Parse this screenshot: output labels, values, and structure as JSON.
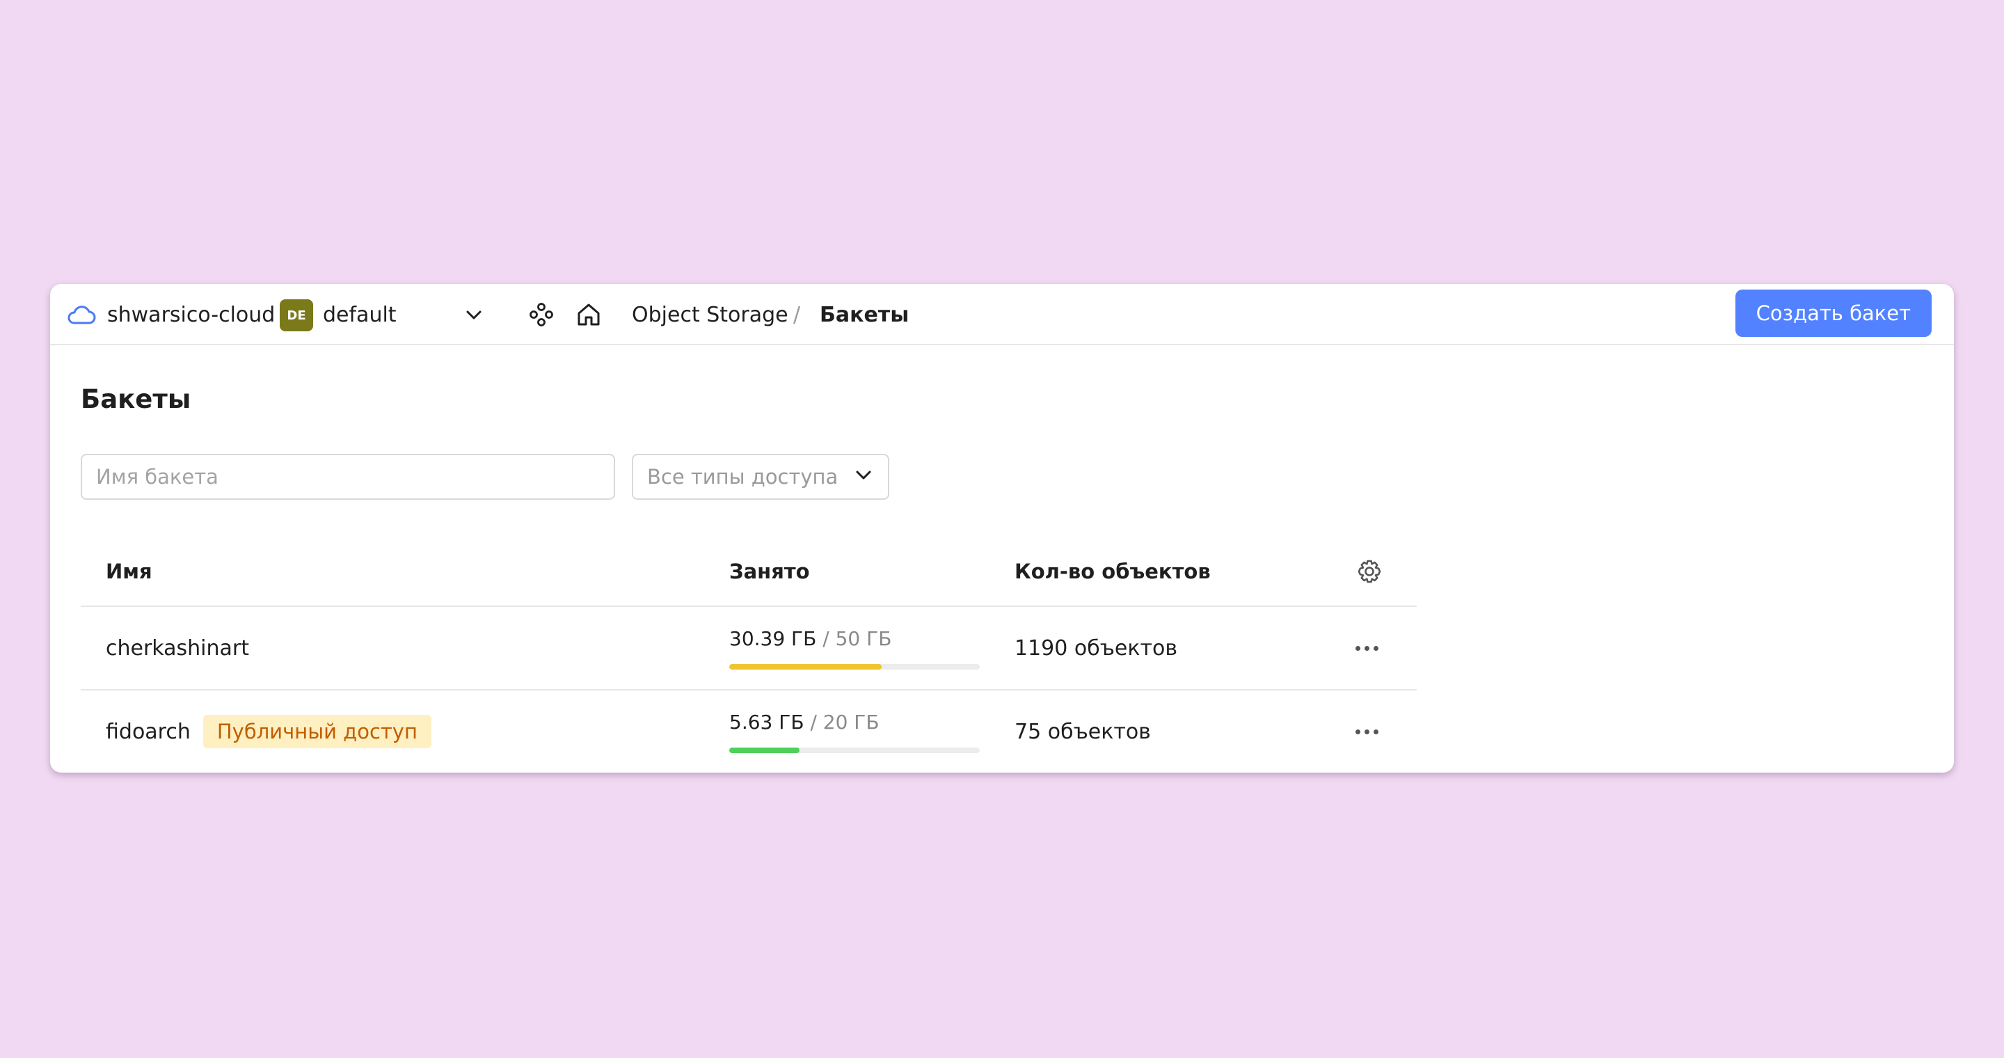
{
  "header": {
    "cloud_name": "shwarsico-cloud",
    "folder_badge": "DE",
    "folder_name": "default",
    "breadcrumb_service": "Object Storage",
    "breadcrumb_separator": "/",
    "breadcrumb_current": "Бакеты",
    "create_button": "Создать бакет"
  },
  "page": {
    "title": "Бакеты",
    "search_placeholder": "Имя бакета",
    "access_filter": "Все типы доступа"
  },
  "table": {
    "columns": {
      "name": "Имя",
      "used": "Занято",
      "count": "Кол-во объектов"
    },
    "rows": [
      {
        "name": "cherkashinart",
        "badge": "",
        "used": "30.39 ГБ",
        "total": "/ 50 ГБ",
        "usage_fraction": 0.608,
        "bar_color": "#f0c42f",
        "objects": "1190 объектов"
      },
      {
        "name": "fidoarch",
        "badge": "Публичный доступ",
        "used": "5.63 ГБ",
        "total": "/ 20 ГБ",
        "usage_fraction": 0.2815,
        "bar_color": "#4fd05b",
        "objects": "75 объектов"
      }
    ]
  },
  "colors": {
    "accent": "#5282ff",
    "background": "#f1d9f3",
    "badge_bg": "#fff0c2",
    "badge_text": "#c25e00"
  }
}
